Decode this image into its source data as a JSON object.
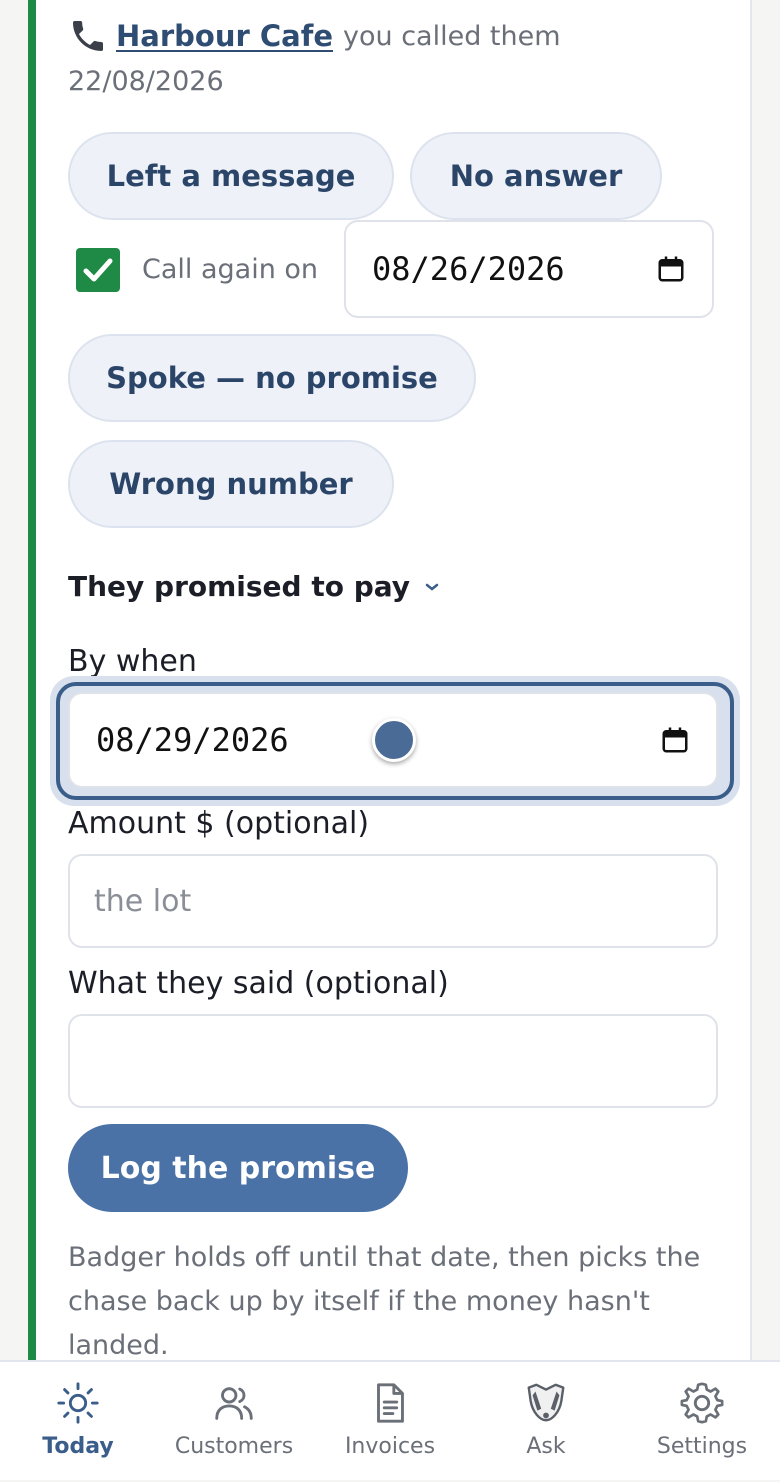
{
  "call": {
    "contact": "Harbour Cafe",
    "suffix": "you called them",
    "date": "22/08/2026"
  },
  "outcomes": {
    "left_message": "Left a message",
    "no_answer": "No answer",
    "spoke_no_promise": "Spoke — no promise",
    "wrong_number": "Wrong number"
  },
  "recall": {
    "checked": true,
    "label": "Call again on",
    "date": "08/26/2026"
  },
  "promise": {
    "heading": "They promised to pay",
    "by_when_label": "By when",
    "by_when_value": "08/29/2026",
    "amount_label": "Amount $ (optional)",
    "amount_placeholder": "the lot",
    "said_label": "What they said (optional)",
    "said_value": "",
    "submit_label": "Log the promise",
    "help": "Badger holds off until that date, then picks the chase back up by itself if the money hasn't landed."
  },
  "tabs": [
    {
      "label": "Today",
      "icon": "sun-icon",
      "active": true
    },
    {
      "label": "Customers",
      "icon": "users-icon",
      "active": false
    },
    {
      "label": "Invoices",
      "icon": "document-icon",
      "active": false
    },
    {
      "label": "Ask",
      "icon": "badger-icon",
      "active": false
    },
    {
      "label": "Settings",
      "icon": "gear-icon",
      "active": false
    }
  ],
  "colors": {
    "accent": "#4a72a7",
    "accent_dark": "#3a5d8a",
    "success": "#1e8a46",
    "pill_bg": "#eef1f8",
    "pill_text": "#2b4568"
  }
}
